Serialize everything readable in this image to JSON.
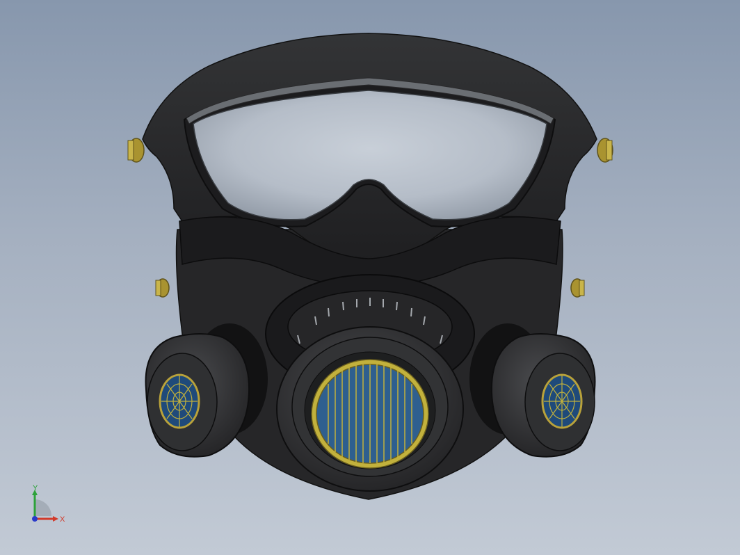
{
  "viewport": {
    "background_top": "#8797ad",
    "background_bottom": "#c2cad5"
  },
  "model": {
    "colors": {
      "rubber": "#2a2a2c",
      "rubber_dark": "#151516",
      "rubber_light": "#3a3b3d",
      "lens": "#c3cad3",
      "brass": "#b9a23a",
      "filter_blue": "#2e5f8f",
      "filter_ring": "#c2b13c"
    }
  },
  "triad": {
    "x_label": "X",
    "y_label": "Y",
    "x_color": "#d23a2a",
    "y_color": "#2da23a",
    "z_color": "#2a3ac9"
  }
}
